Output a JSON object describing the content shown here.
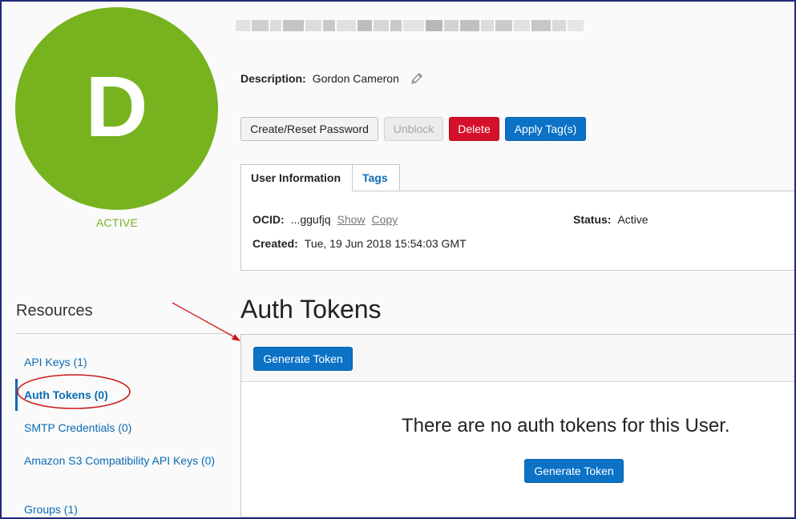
{
  "user": {
    "avatar_letter": "D",
    "status": "ACTIVE",
    "description_label": "Description:",
    "description_value": "Gordon Cameron"
  },
  "actions": {
    "create_reset_password": "Create/Reset Password",
    "unblock": "Unblock",
    "delete": "Delete",
    "apply_tags": "Apply Tag(s)"
  },
  "tabs": {
    "user_information": "User Information",
    "tags": "Tags"
  },
  "info": {
    "ocid_label": "OCID:",
    "ocid_value": "...ggufjq",
    "show": "Show",
    "copy": "Copy",
    "status_label": "Status:",
    "status_value": "Active",
    "created_label": "Created:",
    "created_value": "Tue, 19 Jun 2018 15:54:03 GMT"
  },
  "resources": {
    "title": "Resources",
    "items": [
      {
        "label": "API Keys (1)"
      },
      {
        "label": "Auth Tokens (0)"
      },
      {
        "label": "SMTP Credentials (0)"
      },
      {
        "label": "Amazon S3 Compatibility API Keys (0)"
      },
      {
        "label": "Groups (1)"
      }
    ]
  },
  "auth_tokens": {
    "title": "Auth Tokens",
    "generate_button": "Generate Token",
    "empty_message": "There are no auth tokens for this User.",
    "empty_generate_button": "Generate Token"
  },
  "colors": {
    "avatar_green": "#76b31f",
    "primary_blue": "#0b72c6",
    "link_blue": "#0b6bb5",
    "danger_red": "#d5102a",
    "annotation_red": "#cc1b1b"
  },
  "icons": {
    "edit": "pencil-icon"
  }
}
